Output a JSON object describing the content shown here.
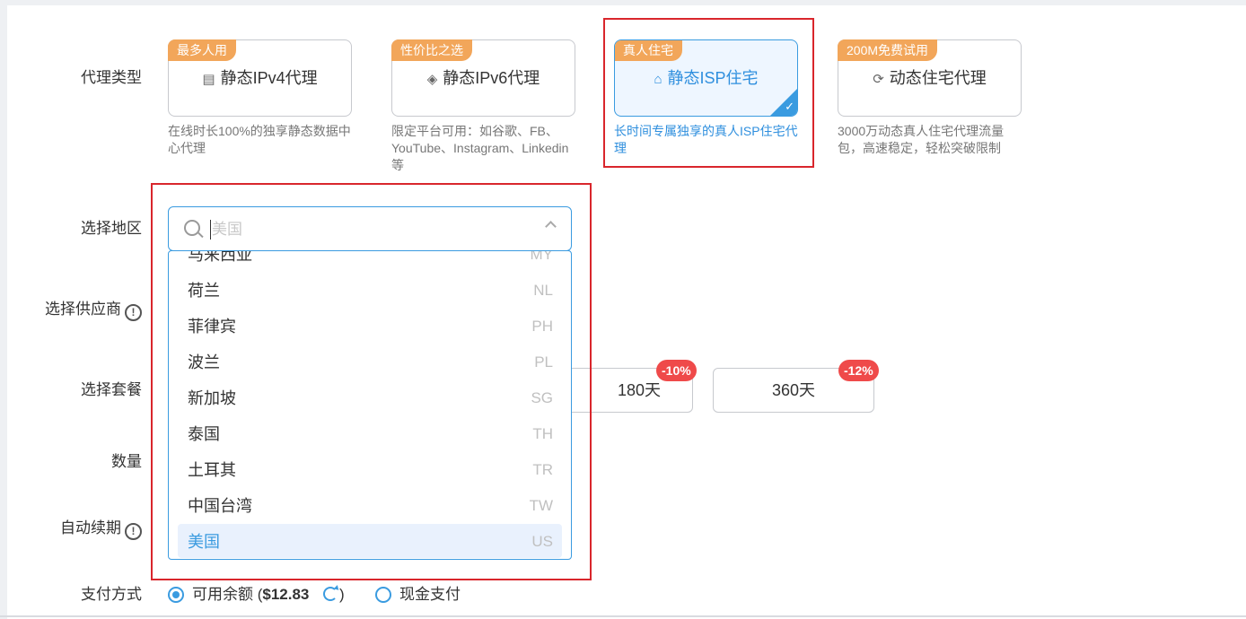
{
  "labels": {
    "proxy_type": "代理类型",
    "select_region": "选择地区",
    "select_provider": "选择供应商",
    "select_plan": "选择套餐",
    "quantity": "数量",
    "auto_renew": "自动续期",
    "payment_method": "支付方式",
    "info_glyph": "!"
  },
  "proxy_types": [
    {
      "tag": "最多人用",
      "icon": "server-icon",
      "title": "静态IPv4代理",
      "desc": "在线时长100%的独享静态数据中心代理",
      "selected": false
    },
    {
      "tag": "性价比之选",
      "icon": "layers-icon",
      "title": "静态IPv6代理",
      "desc": "限定平台可用：如谷歌、FB、YouTube、Instagram、Linkedin等",
      "selected": false
    },
    {
      "tag": "真人住宅",
      "icon": "home-icon",
      "title": "静态ISP住宅",
      "desc": "长时间专属独享的真人ISP住宅代理",
      "selected": true
    },
    {
      "tag": "200M免费试用",
      "icon": "refresh-circle-icon",
      "title": "动态住宅代理",
      "desc": "3000万动态真人住宅代理流量包，高速稳定，轻松突破限制",
      "selected": false
    }
  ],
  "region_search": {
    "placeholder": "美国"
  },
  "region_options": [
    {
      "name": "马来西亚",
      "code": "MY"
    },
    {
      "name": "荷兰",
      "code": "NL"
    },
    {
      "name": "菲律宾",
      "code": "PH"
    },
    {
      "name": "波兰",
      "code": "PL"
    },
    {
      "name": "新加坡",
      "code": "SG"
    },
    {
      "name": "泰国",
      "code": "TH"
    },
    {
      "name": "土耳其",
      "code": "TR"
    },
    {
      "name": "中国台湾",
      "code": "TW"
    },
    {
      "name": "美国",
      "code": "US",
      "selected": true
    }
  ],
  "plans": [
    {
      "label": "180天",
      "discount": "-10%"
    },
    {
      "label": "360天",
      "discount": "-12%"
    }
  ],
  "payment": {
    "balance_label": "可用余额 (",
    "balance_value": "$12.83",
    "balance_close": ")",
    "balance_selected": true,
    "cash_label": "现金支付"
  },
  "colors": {
    "accent": "#3a9be0",
    "tag": "#f2a65a",
    "discount": "#ef4a4a",
    "highlight_border": "#d9262c"
  }
}
